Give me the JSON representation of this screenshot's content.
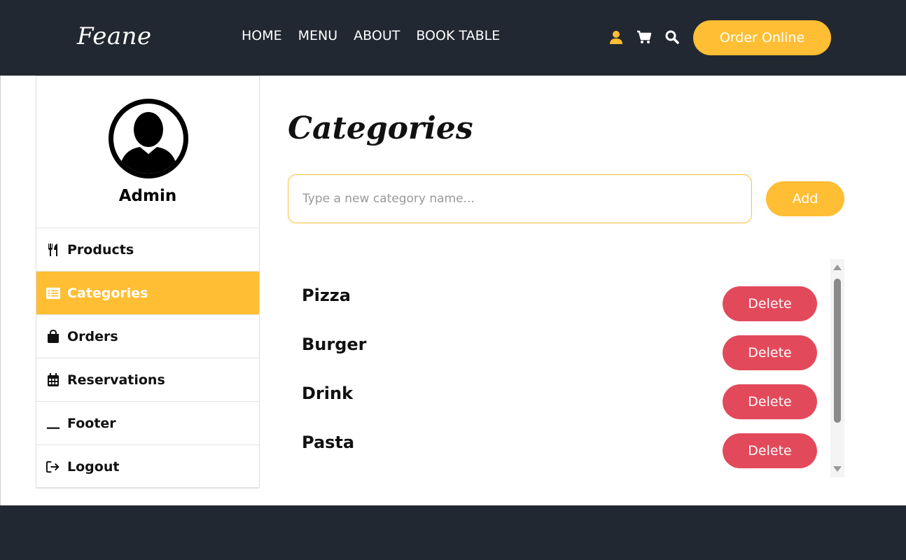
{
  "brand": {
    "logo": "Feane"
  },
  "nav": {
    "items": [
      {
        "label": "HOME"
      },
      {
        "label": "MENU"
      },
      {
        "label": "ABOUT"
      },
      {
        "label": "BOOK TABLE"
      }
    ],
    "order_button": "Order Online"
  },
  "header_icons": [
    "user-icon",
    "cart-icon",
    "search-icon"
  ],
  "sidebar": {
    "profile_name": "Admin",
    "items": [
      {
        "label": "Products",
        "icon": "utensils-icon",
        "active": false
      },
      {
        "label": "Categories",
        "icon": "list-icon",
        "active": true
      },
      {
        "label": "Orders",
        "icon": "shopping-bag-icon",
        "active": false
      },
      {
        "label": "Reservations",
        "icon": "calendar-icon",
        "active": false
      },
      {
        "label": "Footer",
        "icon": "underline-icon",
        "active": false
      },
      {
        "label": "Logout",
        "icon": "logout-icon",
        "active": false
      }
    ]
  },
  "main": {
    "title": "Categories",
    "input": {
      "placeholder": "Type a new category name...",
      "value": ""
    },
    "add_button": "Add",
    "categories": [
      {
        "name": "Pizza",
        "action": "Delete"
      },
      {
        "name": "Burger",
        "action": "Delete"
      },
      {
        "name": "Drink",
        "action": "Delete"
      },
      {
        "name": "Pasta",
        "action": "Delete"
      }
    ]
  },
  "colors": {
    "dark": "#222831",
    "accent": "#ffbe33",
    "danger": "#e24a5b"
  }
}
